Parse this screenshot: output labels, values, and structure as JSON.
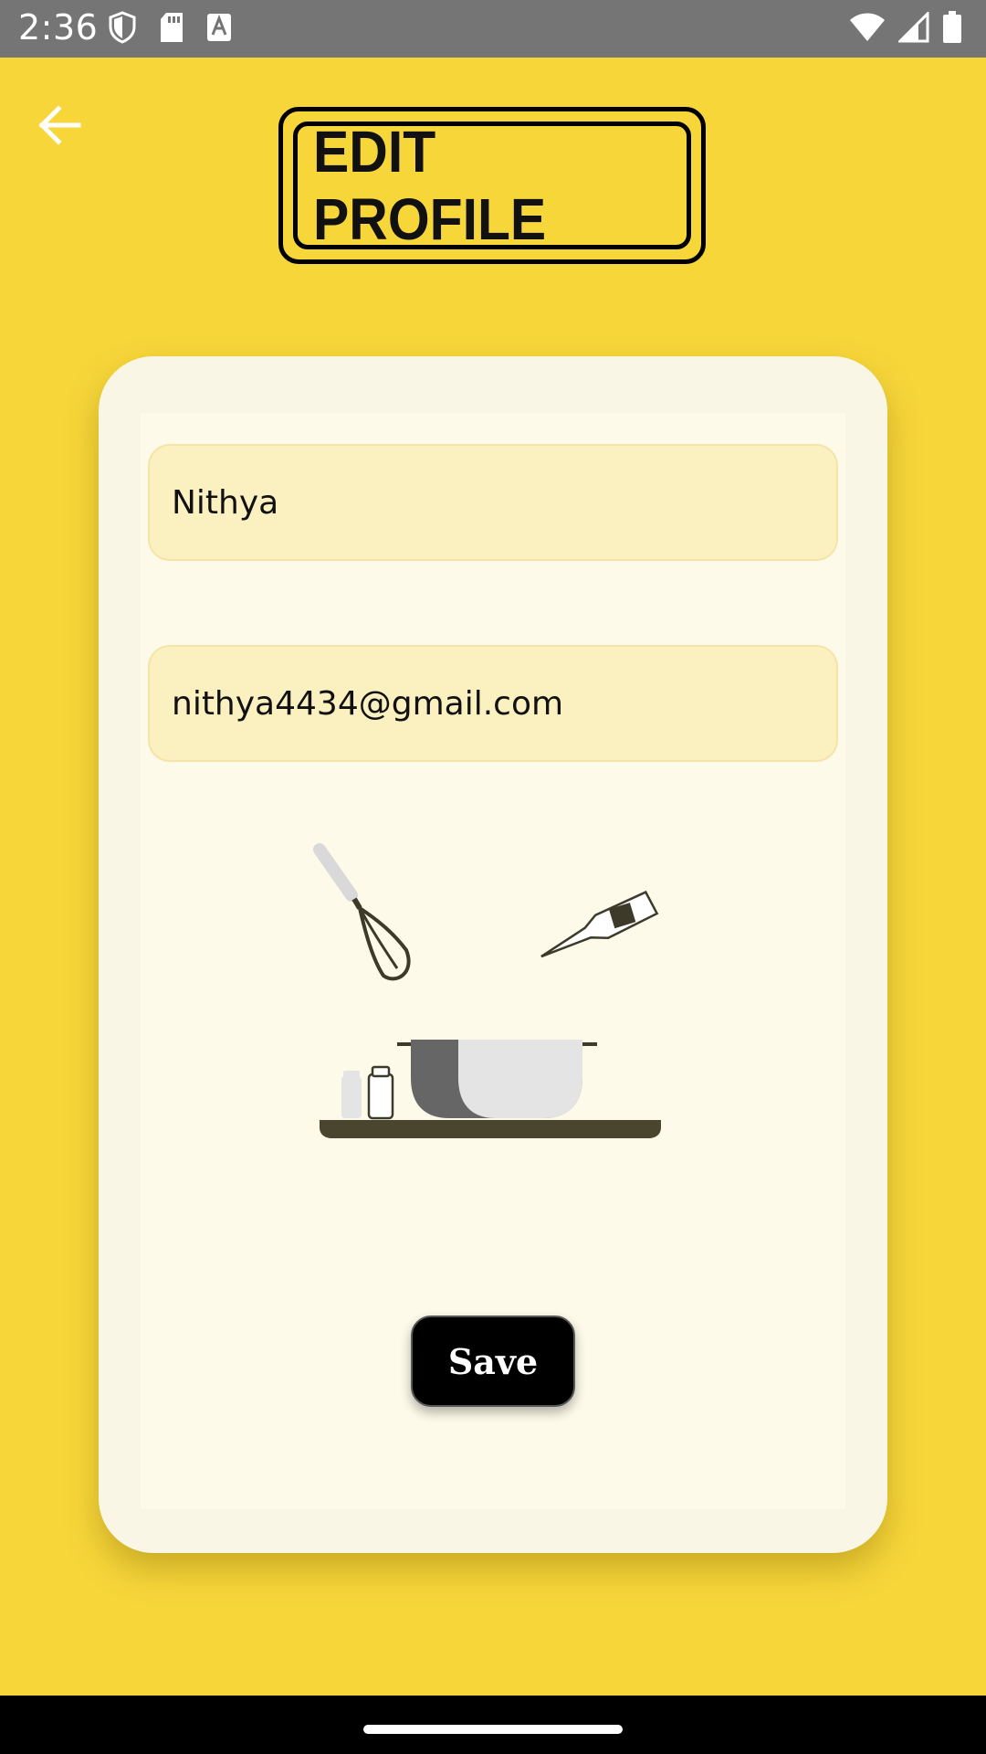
{
  "status_bar": {
    "time": "2:36",
    "left_icons": [
      "shield-icon",
      "sd-card-icon",
      "font-a-icon"
    ],
    "right_icons": [
      "wifi-icon",
      "cellular-signal-icon",
      "battery-icon"
    ]
  },
  "header": {
    "back_icon": "arrow-left-icon",
    "title": "EDIT PROFILE"
  },
  "form": {
    "name_value": "Nithya",
    "email_value": "nithya4434@gmail.com",
    "illustration": "cooking-utensils-illustration",
    "save_label": "Save"
  },
  "colors": {
    "background": "#f7d63a",
    "card": "#faf6e6",
    "field": "#fbf0c0",
    "button": "#000000",
    "status_bar": "#757575"
  }
}
